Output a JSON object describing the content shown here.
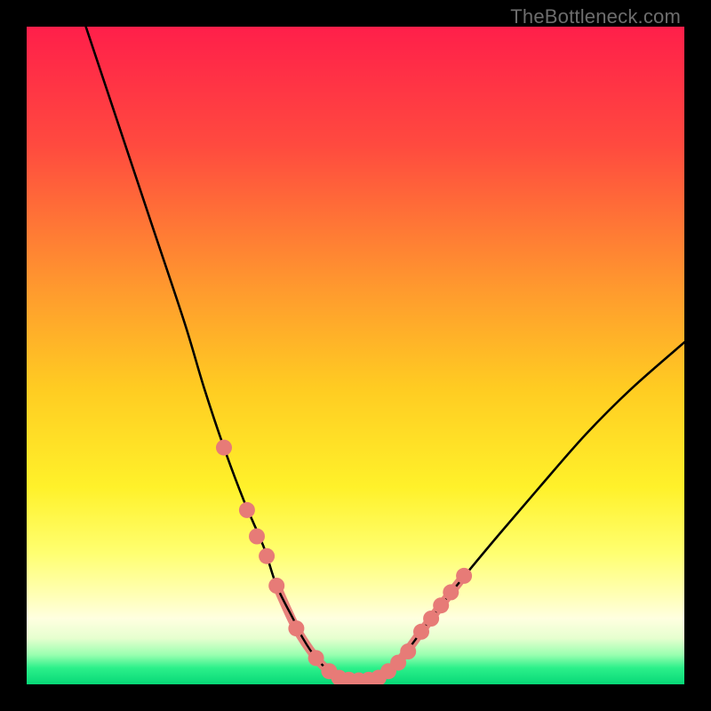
{
  "watermark": "TheBottleneck.com",
  "chart_data": {
    "type": "line",
    "title": "",
    "xlabel": "",
    "ylabel": "",
    "xrange": [
      0,
      100
    ],
    "yrange": [
      0,
      100
    ],
    "series": [
      {
        "name": "left-curve",
        "x": [
          9,
          14,
          19,
          24,
          27,
          30,
          33,
          36,
          38,
          40.5,
          42,
          44,
          46,
          47.5
        ],
        "y": [
          100,
          85,
          70,
          55,
          45,
          36,
          28,
          21,
          15,
          10,
          7,
          4,
          2,
          1
        ]
      },
      {
        "name": "right-curve",
        "x": [
          53.5,
          55,
          57,
          60,
          63,
          67,
          72,
          78,
          85,
          92,
          100
        ],
        "y": [
          1,
          2,
          4,
          8,
          12,
          17,
          23,
          30,
          38,
          45,
          52
        ]
      },
      {
        "name": "flat-bottom",
        "x": [
          47.5,
          49,
          50.5,
          52,
          53.5
        ],
        "y": [
          1,
          0.7,
          0.6,
          0.7,
          1
        ]
      }
    ],
    "marker_series": [
      {
        "name": "left-markers",
        "x": [
          30,
          33.5,
          35,
          36.5,
          38,
          41,
          44,
          46,
          47.5,
          49,
          50.5,
          52,
          53.5
        ],
        "y": [
          36,
          26.5,
          22.5,
          19.5,
          15,
          8.5,
          4,
          2,
          1,
          0.7,
          0.6,
          0.7,
          1
        ]
      },
      {
        "name": "right-markers",
        "x": [
          55,
          56.5,
          58,
          60,
          61.5,
          63
        ],
        "y": [
          2,
          3.3,
          5,
          8,
          10,
          12
        ]
      },
      {
        "name": "right-upper-markers",
        "x": [
          64.5,
          66.5
        ],
        "y": [
          14,
          16.5
        ]
      }
    ],
    "gradient_stops": [
      {
        "offset": 0.0,
        "color": "#ff1f4a"
      },
      {
        "offset": 0.18,
        "color": "#ff4a3f"
      },
      {
        "offset": 0.4,
        "color": "#ff9a2e"
      },
      {
        "offset": 0.55,
        "color": "#ffcc22"
      },
      {
        "offset": 0.7,
        "color": "#fff12a"
      },
      {
        "offset": 0.8,
        "color": "#ffff70"
      },
      {
        "offset": 0.86,
        "color": "#ffffb0"
      },
      {
        "offset": 0.9,
        "color": "#ffffe0"
      },
      {
        "offset": 0.93,
        "color": "#e6ffcf"
      },
      {
        "offset": 0.955,
        "color": "#9affb0"
      },
      {
        "offset": 0.975,
        "color": "#2cf08a"
      },
      {
        "offset": 1.0,
        "color": "#07d877"
      }
    ],
    "marker_color": "#e77b77",
    "curve_color": "#000000",
    "bottom_highlight_color": "#e77b77"
  }
}
